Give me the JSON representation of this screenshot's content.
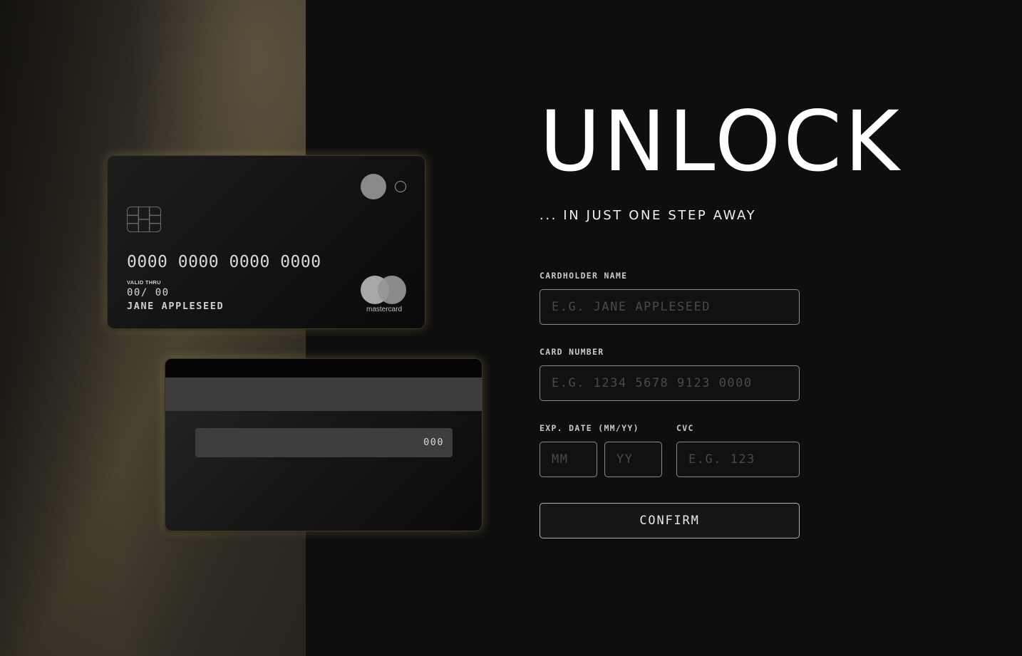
{
  "hero": {
    "title": "UNLOCK",
    "subtitle": "... IN JUST ONE STEP AWAY"
  },
  "card_front": {
    "number": "0000 0000 0000 0000",
    "valid_label": "VALID THRU",
    "expiry": "00/ 00",
    "holder": "JANE APPLESEED",
    "brand_text": "mastercard"
  },
  "card_back": {
    "cvc": "000"
  },
  "form": {
    "cardholder_label": "CARDHOLDER NAME",
    "cardholder_placeholder": "E.G. JANE APPLESEED",
    "number_label": "CARD NUMBER",
    "number_placeholder": "E.G. 1234 5678 9123 0000",
    "exp_label": "EXP. DATE (MM/YY)",
    "mm_placeholder": "MM",
    "yy_placeholder": "YY",
    "cvc_label": "CVC",
    "cvc_placeholder": "E.G. 123",
    "confirm_label": "CONFIRM"
  },
  "colors": {
    "background": "#0e0e0e",
    "card_glow": "#c9a868",
    "left_panel": "#4a4232"
  }
}
